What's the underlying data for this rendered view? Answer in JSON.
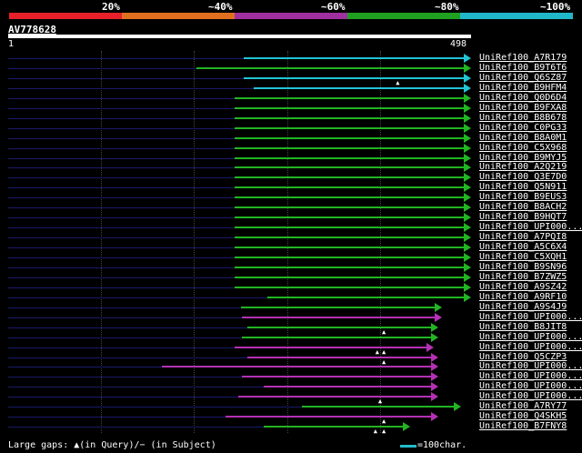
{
  "legend": {
    "labels": [
      "20%",
      "~40%",
      "~60%",
      "~80%",
      "~100%"
    ],
    "colors": [
      "#e8202a",
      "#e07020",
      "#a030a0",
      "#20a020",
      "#20b8c8"
    ]
  },
  "query": {
    "name": "AV778628",
    "start_label": "1",
    "end_label": "498"
  },
  "colors": {
    "cyan": "#22c4d4",
    "green": "#22b422",
    "magenta": "#b430b4"
  },
  "hits": [
    {
      "name": "UniRef100_A7R179",
      "color": "cyan",
      "start": 253,
      "end": 498,
      "gaps": []
    },
    {
      "name": "UniRef100_B9T6T6",
      "color": "green",
      "start": 203,
      "end": 498,
      "gaps": []
    },
    {
      "name": "UniRef100_Q6SZ87",
      "color": "cyan",
      "start": 253,
      "end": 498,
      "gaps": [
        420
      ]
    },
    {
      "name": "UniRef100_B9HFM4",
      "color": "cyan",
      "start": 264,
      "end": 498,
      "gaps": []
    },
    {
      "name": "UniRef100_Q0D6D4",
      "color": "green",
      "start": 244,
      "end": 498,
      "gaps": []
    },
    {
      "name": "UniRef100_B9FXA8",
      "color": "green",
      "start": 244,
      "end": 498,
      "gaps": []
    },
    {
      "name": "UniRef100_B8B678",
      "color": "green",
      "start": 244,
      "end": 498,
      "gaps": []
    },
    {
      "name": "UniRef100_C0PG33",
      "color": "green",
      "start": 244,
      "end": 498,
      "gaps": []
    },
    {
      "name": "UniRef100_B8A0M1",
      "color": "green",
      "start": 244,
      "end": 498,
      "gaps": []
    },
    {
      "name": "UniRef100_C5X968",
      "color": "green",
      "start": 244,
      "end": 498,
      "gaps": []
    },
    {
      "name": "UniRef100_B9MYJ5",
      "color": "green",
      "start": 244,
      "end": 498,
      "gaps": []
    },
    {
      "name": "UniRef100_A2Q219",
      "color": "green",
      "start": 244,
      "end": 498,
      "gaps": []
    },
    {
      "name": "UniRef100_Q3E7D0",
      "color": "green",
      "start": 244,
      "end": 498,
      "gaps": []
    },
    {
      "name": "UniRef100_Q5N911",
      "color": "green",
      "start": 244,
      "end": 498,
      "gaps": []
    },
    {
      "name": "UniRef100_B9EUS3",
      "color": "green",
      "start": 244,
      "end": 498,
      "gaps": []
    },
    {
      "name": "UniRef100_B8ACH2",
      "color": "green",
      "start": 244,
      "end": 498,
      "gaps": []
    },
    {
      "name": "UniRef100_B9HQT7",
      "color": "green",
      "start": 244,
      "end": 498,
      "gaps": []
    },
    {
      "name": "UniRef100_UPI000...",
      "color": "green",
      "start": 244,
      "end": 498,
      "gaps": []
    },
    {
      "name": "UniRef100_A7PQI8",
      "color": "green",
      "start": 244,
      "end": 498,
      "gaps": []
    },
    {
      "name": "UniRef100_A5C6X4",
      "color": "green",
      "start": 244,
      "end": 498,
      "gaps": []
    },
    {
      "name": "UniRef100_C5XQH1",
      "color": "green",
      "start": 244,
      "end": 498,
      "gaps": []
    },
    {
      "name": "UniRef100_B9SN96",
      "color": "green",
      "start": 244,
      "end": 498,
      "gaps": []
    },
    {
      "name": "UniRef100_B7ZWZ5",
      "color": "green",
      "start": 244,
      "end": 498,
      "gaps": []
    },
    {
      "name": "UniRef100_A9SZ42",
      "color": "green",
      "start": 244,
      "end": 498,
      "gaps": []
    },
    {
      "name": "UniRef100_A9RF10",
      "color": "green",
      "start": 279,
      "end": 498,
      "gaps": []
    },
    {
      "name": "UniRef100_A9S4J9",
      "color": "green",
      "start": 250,
      "end": 467,
      "gaps": []
    },
    {
      "name": "UniRef100_UPI000...",
      "color": "magenta",
      "start": 251,
      "end": 467,
      "gaps": []
    },
    {
      "name": "UniRef100_B8JIT8",
      "color": "green",
      "start": 257,
      "end": 463,
      "gaps": [
        405
      ]
    },
    {
      "name": "UniRef100_UPI000...",
      "color": "green",
      "start": 251,
      "end": 463,
      "gaps": []
    },
    {
      "name": "UniRef100_UPI000...",
      "color": "magenta",
      "start": 244,
      "end": 458,
      "gaps": [
        398,
        405
      ]
    },
    {
      "name": "UniRef100_Q5CZP3",
      "color": "magenta",
      "start": 257,
      "end": 463,
      "gaps": [
        405
      ]
    },
    {
      "name": "UniRef100_UPI000...",
      "color": "magenta",
      "start": 165,
      "end": 463,
      "gaps": []
    },
    {
      "name": "UniRef100_UPI000...",
      "color": "magenta",
      "start": 251,
      "end": 463,
      "gaps": []
    },
    {
      "name": "UniRef100_UPI000...",
      "color": "magenta",
      "start": 275,
      "end": 463,
      "gaps": []
    },
    {
      "name": "UniRef100_UPI000...",
      "color": "magenta",
      "start": 248,
      "end": 463,
      "gaps": [
        401
      ]
    },
    {
      "name": "UniRef100_A7RY77",
      "color": "green",
      "start": 316,
      "end": 487,
      "gaps": []
    },
    {
      "name": "UniRef100_Q4SKH5",
      "color": "magenta",
      "start": 234,
      "end": 463,
      "gaps": [
        405
      ]
    },
    {
      "name": "UniRef100_B7FNY8",
      "color": "green",
      "start": 275,
      "end": 432,
      "gaps": [
        396,
        405
      ]
    }
  ],
  "footer": {
    "gaps_label": "Large gaps: ▲(in Query)/− (in Subject)",
    "scale_label": "=100char."
  }
}
